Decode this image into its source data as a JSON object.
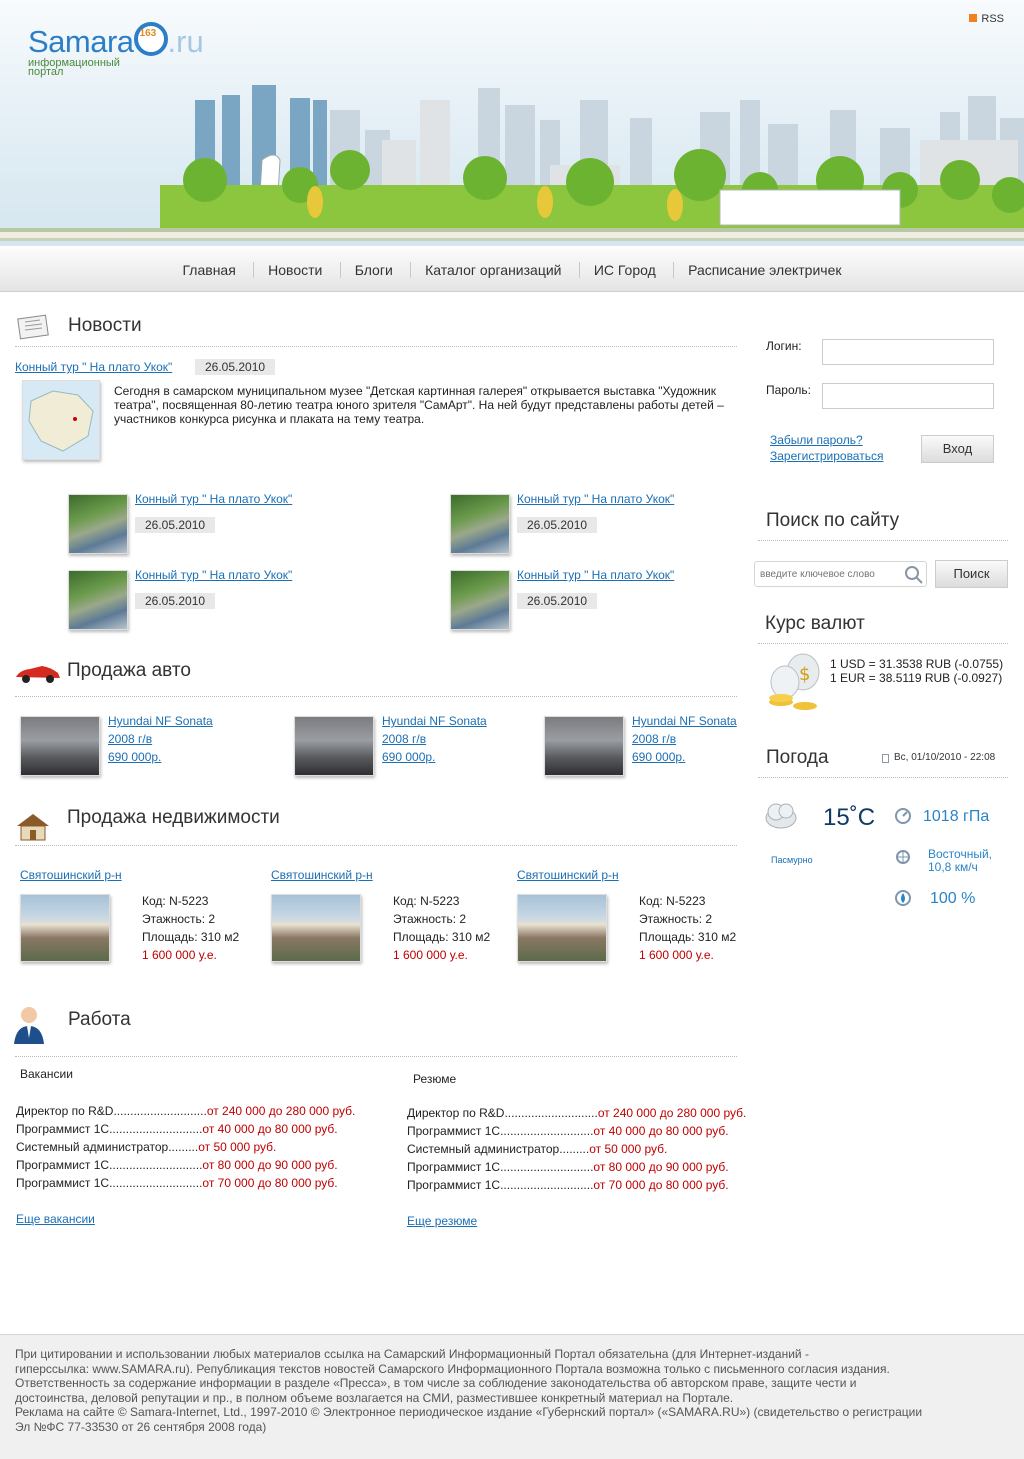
{
  "header": {
    "logo_word": "Samara",
    "logo_num": "163",
    "logo_ru": ".ru",
    "logo_sub1": "информационный",
    "logo_sub2": "портал",
    "rss": "RSS"
  },
  "nav": [
    "Главная",
    "Новости",
    "Блоги",
    "Каталог организаций",
    "ИС Город",
    "Расписание электричек"
  ],
  "news": {
    "title": "Новости",
    "main": {
      "link": "Конный тур \" На плато Укок\"",
      "date": "26.05.2010",
      "text": "Сегодня в самарском муниципальном музее \"Детская картинная галерея\" открывается выставка \"Художник театра\", посвященная 80-летию театра юного зрителя \"СамАрт\". На ней будут представлены работы детей – участников конкурса рисунка и плаката на тему театра."
    },
    "items": [
      {
        "link": "Конный тур \" На плато Укок\"",
        "date": "26.05.2010"
      },
      {
        "link": "Конный тур \" На плато Укок\"",
        "date": "26.05.2010"
      },
      {
        "link": "Конный тур \" На плато Укок\"",
        "date": "26.05.2010"
      },
      {
        "link": "Конный тур \" На плато Укок\"",
        "date": "26.05.2010"
      }
    ]
  },
  "auto": {
    "title": "Продажа авто",
    "items": [
      {
        "name": "Hyundai NF Sonata",
        "year": "2008 г/в",
        "price": "690 000р."
      },
      {
        "name": "Hyundai NF Sonata",
        "year": "2008 г/в",
        "price": "690 000р."
      },
      {
        "name": "Hyundai NF Sonata",
        "year": "2008 г/в",
        "price": "690 000р."
      }
    ]
  },
  "realty": {
    "title": "Продажа недвижимости",
    "items": [
      {
        "district": "Святошинский р-н",
        "code": "Код: N-5223",
        "floors": "Этажность: 2",
        "area": "Площадь: 310 м2",
        "price": "1 600 000 у.е."
      },
      {
        "district": "Святошинский р-н",
        "code": "Код: N-5223",
        "floors": "Этажность: 2",
        "area": "Площадь: 310 м2",
        "price": "1 600 000 у.е."
      },
      {
        "district": "Святошинский р-н",
        "code": "Код: N-5223",
        "floors": "Этажность: 2",
        "area": "Площадь: 310 м2",
        "price": "1 600 000 у.е."
      }
    ]
  },
  "work": {
    "title": "Работа",
    "vacancies_label": "Вакансии",
    "resume_label": "Резюме",
    "rows": [
      {
        "name": "Директор по R&D............................",
        "salary": "от 240 000 до 280 000 руб."
      },
      {
        "name": "Программист 1С............................",
        "salary": "от 40 000 до 80 000 руб."
      },
      {
        "name": "Системный администратор.........",
        "salary": "от 50 000 руб."
      },
      {
        "name": "Программист 1С............................",
        "salary": "от 80 000 до 90 000 руб."
      },
      {
        "name": "Программист 1С............................",
        "salary": "от 70 000 до 80 000 руб."
      }
    ],
    "more_vacancies": "Еще вакансии",
    "more_resume": "Еще резюме"
  },
  "login": {
    "login_label": "Логин:",
    "password_label": "Пароль:",
    "forgot": "Забыли пароль?",
    "register": "Зарегистрироваться",
    "submit": "Вход"
  },
  "search": {
    "title": "Поиск по сайту",
    "placeholder": "введите ключевое слово",
    "button": "Поиск"
  },
  "currency": {
    "title": "Курс валют",
    "usd": "1 USD = 31.3538 RUB (-0.0755)",
    "eur": "1 EUR = 38.5119 RUB (-0.0927)"
  },
  "weather": {
    "title": "Погода",
    "datetime": "Вс, 01/10/2010 - 22:08",
    "temp": "15˚C",
    "condition": "Пасмурно",
    "pressure": "1018 гПа",
    "wind1": "Восточный,",
    "wind2": "10,8 км/ч",
    "humidity": "100 %"
  },
  "footer": {
    "lines": [
      "При цитировании и использовании любых материалов ссылка на Самарский Информационный Портал обязательна (для Интернет-изданий -",
      "гиперссылка: www.SAMARA.ru). Републикация текстов новостей Самарского Информационного Портала возможна только с письменного согласия издания.",
      "Ответственность за содержание информации в разделе «Пресса», в том числе за соблюдение законодательства об авторском праве, защите чести и",
      "достоинства, деловой репутации и пр., в полном объеме возлагается на СМИ, разместившее конкретный материал на Портале.",
      "Реклама на сайте © Samara-Internet, Ltd., 1997-2010 © Электронное периодическое издание «Губернский портал» («SAMARA.RU») (свидетельство о регистрации",
      "Эл №ФС 77-33530 от 26 сентября 2008 года)"
    ]
  }
}
